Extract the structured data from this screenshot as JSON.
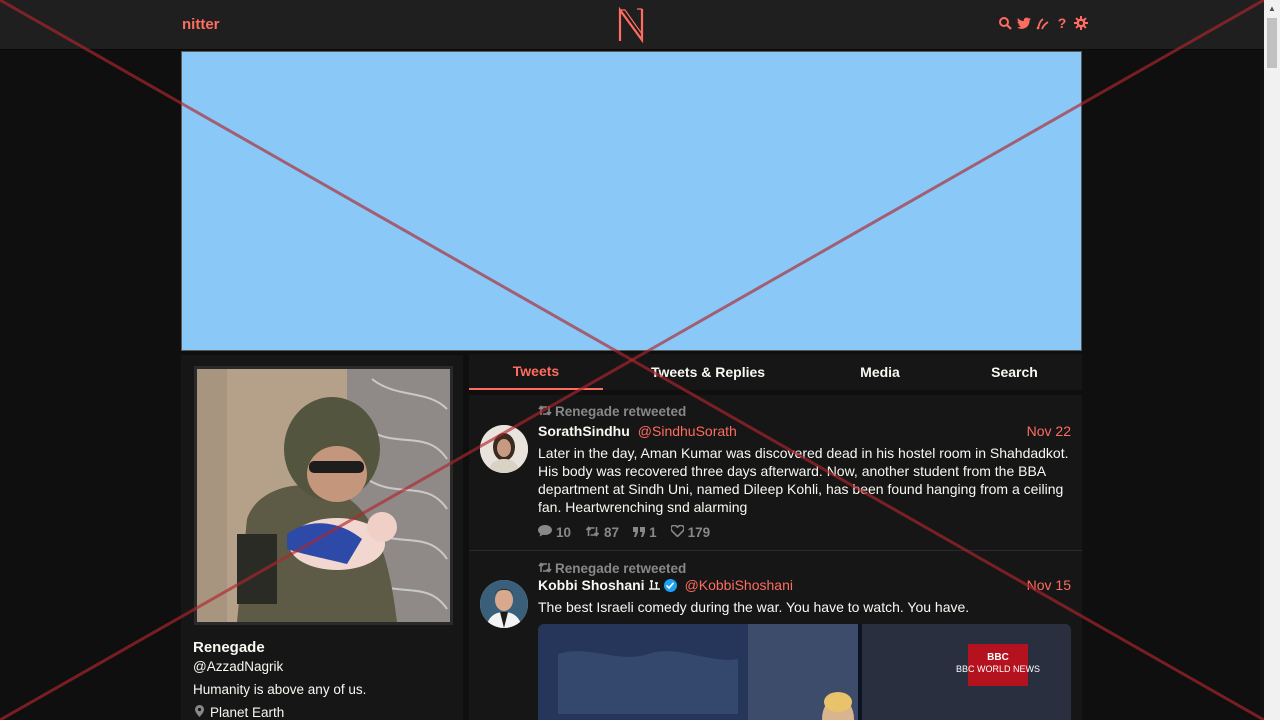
{
  "nav": {
    "brand": "nitter",
    "logo_letter": "N",
    "icons": [
      "search-icon",
      "twitter-icon",
      "rss-icon",
      "help-icon",
      "gear-icon"
    ],
    "help_glyph": "?"
  },
  "profile": {
    "fullname": "Renegade",
    "username": "@AzzadNagrik",
    "bio": "Humanity is above any of us.",
    "location": "Planet Earth"
  },
  "tabs": [
    {
      "label": "Tweets",
      "active": true
    },
    {
      "label": "Tweets & Replies",
      "active": false
    },
    {
      "label": "Media",
      "active": false
    },
    {
      "label": "Search",
      "active": false
    }
  ],
  "tweets": [
    {
      "retweet_header": "Renegade retweeted",
      "fullname": "SorathSindhu",
      "handle": "@SindhuSorath",
      "date": "Nov 22",
      "body": "Later in the day, Aman Kumar was discovered dead in his hostel room in Shahdadkot. His body was recovered three days afterward. Now, another student from the BBA department at Sindh Uni, named Dileep Kohli, has been found hanging from a ceiling fan. Heartwrenching snd alarming",
      "stats": {
        "replies": "10",
        "retweets": "87",
        "quotes": "1",
        "likes": "179"
      }
    },
    {
      "retweet_header": "Renegade retweeted",
      "fullname": "Kobbi Shoshani",
      "handle": "@KobbiShoshani",
      "date": "Nov 15",
      "body": "The best Israeli comedy during the war. You have to watch. You have.",
      "media_text": "BBC WORLD NEWS"
    }
  ],
  "colors": {
    "accent": "#ff6c60",
    "background": "#0f0f0f",
    "panel": "#161616",
    "navbar": "#1f1f1f",
    "banner": "#89c8f7",
    "muted": "#888889",
    "cross": "#b0262e"
  }
}
